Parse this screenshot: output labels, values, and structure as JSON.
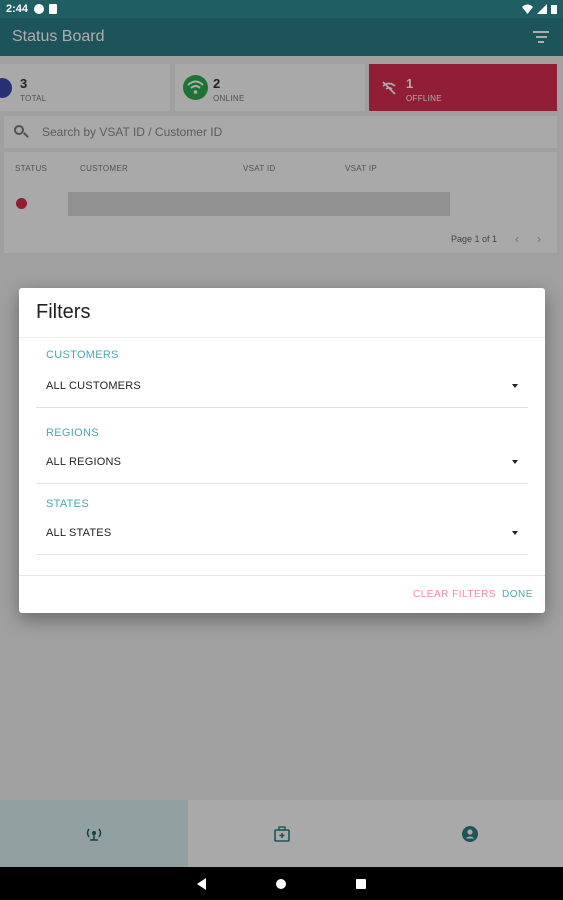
{
  "status_bar": {
    "time": "2:44"
  },
  "app": {
    "title": "Status Board"
  },
  "summary": {
    "total": {
      "count": "3",
      "label": "TOTAL"
    },
    "online": {
      "count": "2",
      "label": "ONLINE"
    },
    "offline": {
      "count": "1",
      "label": "OFFLINE"
    }
  },
  "search": {
    "placeholder": "Search by VSAT ID / Customer ID"
  },
  "table": {
    "columns": [
      "STATUS",
      "CUSTOMER",
      "VSAT ID",
      "VSAT IP"
    ],
    "pagination": "Page 1 of 1"
  },
  "dialog": {
    "title": "Filters",
    "sections": [
      {
        "label": "CUSTOMERS",
        "value": "ALL CUSTOMERS"
      },
      {
        "label": "REGIONS",
        "value": "ALL REGIONS"
      },
      {
        "label": "STATES",
        "value": "ALL STATES"
      }
    ],
    "clear_label": "CLEAR FILTERS",
    "done_label": "DONE"
  },
  "colors": {
    "appbar": "#2a7d85",
    "accent": "#4aa7b0",
    "offline": "#d72d4e",
    "online": "#2fa84f",
    "total": "#3949ab"
  }
}
